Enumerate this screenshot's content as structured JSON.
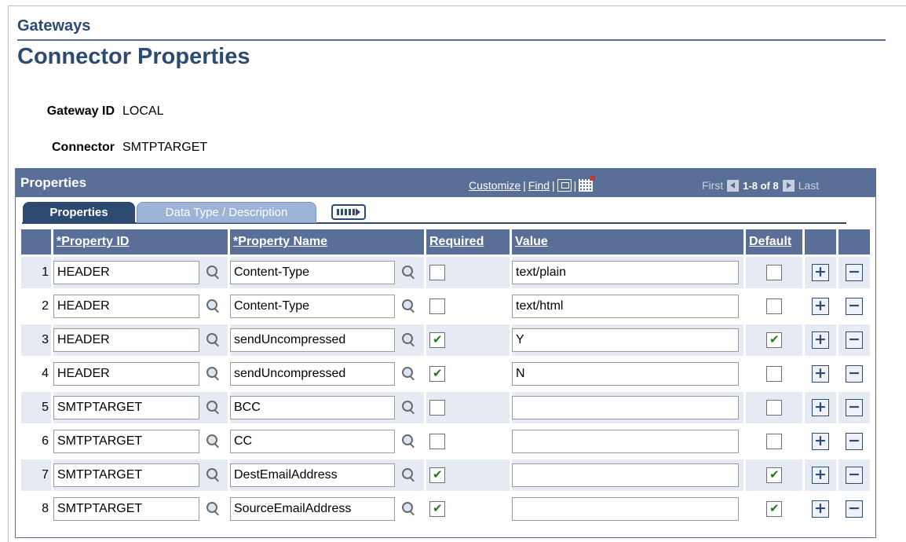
{
  "breadcrumb": "Gateways",
  "page_title": "Connector Properties",
  "fields": {
    "gateway_id_label": "Gateway ID",
    "gateway_id_value": "LOCAL",
    "connector_label": "Connector",
    "connector_value": "SMTPTARGET"
  },
  "grid": {
    "title": "Properties",
    "customize": "Customize",
    "find": "Find",
    "separator": "|",
    "first": "First",
    "range": "1-8 of 8",
    "last": "Last",
    "tabs": [
      "Properties",
      "Data Type / Description"
    ],
    "columns": {
      "property_id": "*Property ID",
      "property_name": "*Property Name",
      "required": "Required",
      "value": "Value",
      "default": "Default"
    },
    "rows": [
      {
        "num": "1",
        "property_id": "HEADER",
        "property_name": "Content-Type",
        "required": false,
        "value": "text/plain",
        "default": false
      },
      {
        "num": "2",
        "property_id": "HEADER",
        "property_name": "Content-Type",
        "required": false,
        "value": "text/html",
        "default": false
      },
      {
        "num": "3",
        "property_id": "HEADER",
        "property_name": "sendUncompressed",
        "required": true,
        "value": "Y",
        "default": true
      },
      {
        "num": "4",
        "property_id": "HEADER",
        "property_name": "sendUncompressed",
        "required": true,
        "value": "N",
        "default": false
      },
      {
        "num": "5",
        "property_id": "SMTPTARGET",
        "property_name": "BCC",
        "required": false,
        "value": "",
        "default": false
      },
      {
        "num": "6",
        "property_id": "SMTPTARGET",
        "property_name": "CC",
        "required": false,
        "value": "",
        "default": false
      },
      {
        "num": "7",
        "property_id": "SMTPTARGET",
        "property_name": "DestEmailAddress",
        "required": true,
        "value": "",
        "default": true
      },
      {
        "num": "8",
        "property_id": "SMTPTARGET",
        "property_name": "SourceEmailAddress",
        "required": true,
        "value": "",
        "default": true
      }
    ],
    "add_symbol": "+",
    "delete_symbol": "−"
  },
  "colors": {
    "title_blue": "#2d4a73",
    "grid_header": "#5a6f97",
    "alt_row": "#e6eaf2"
  }
}
